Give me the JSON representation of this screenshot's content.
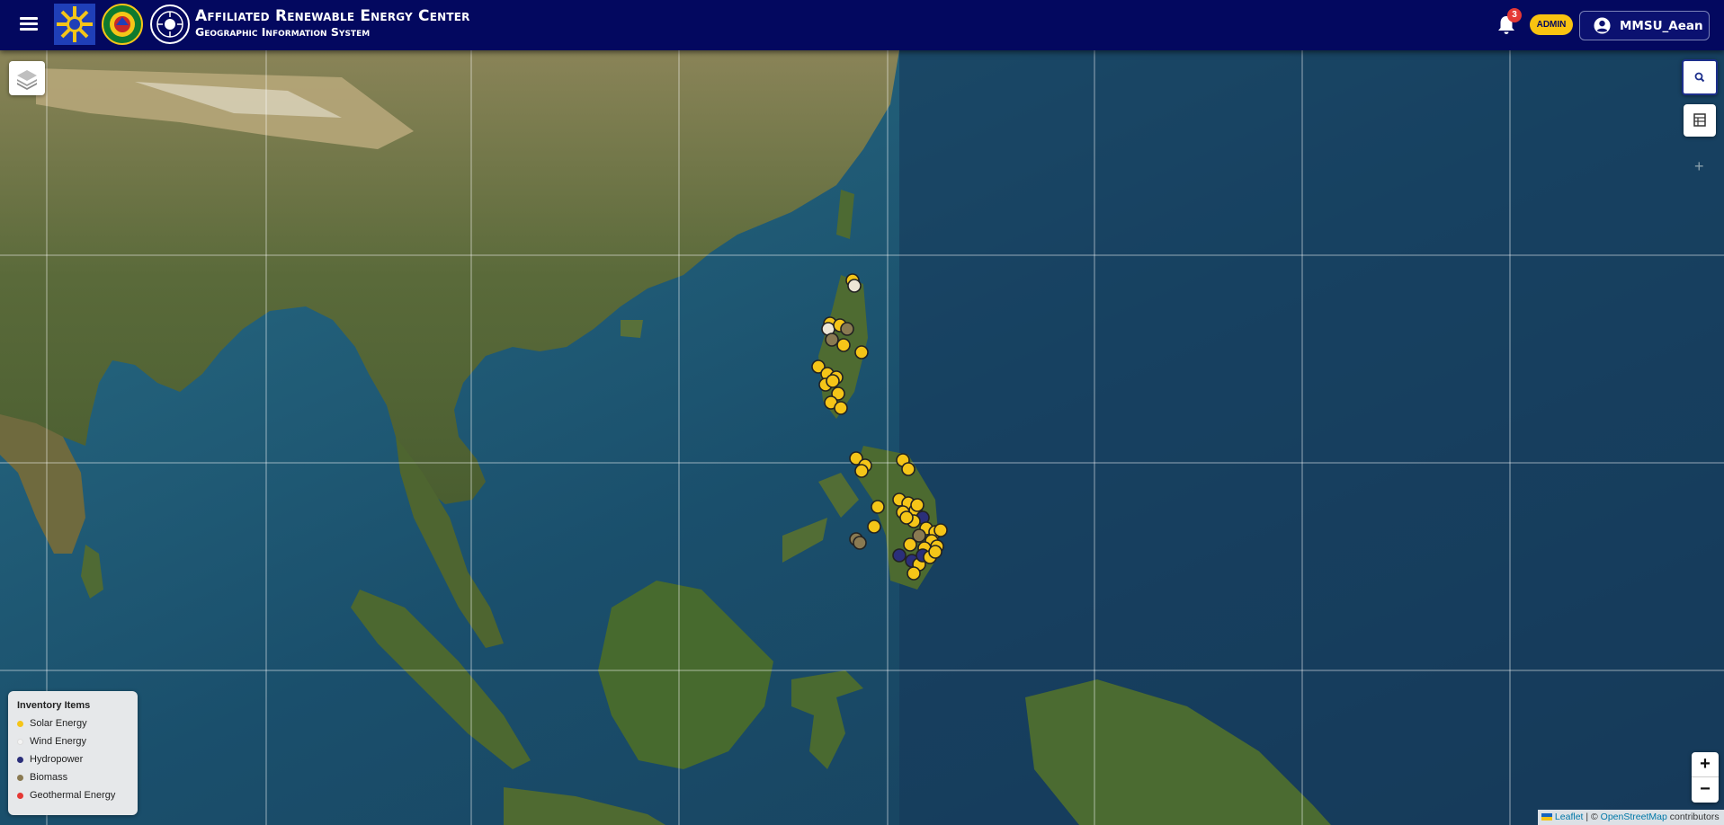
{
  "header": {
    "title": "Affiliated Renewable Energy Center",
    "subtitle": "Geographic Information System",
    "notification_count": "3",
    "role_badge": "ADMIN",
    "username": "MMSU_Aean"
  },
  "map": {
    "basemap": "satellite imagery",
    "legend": {
      "title": "Inventory Items",
      "items": [
        {
          "label": "Solar Energy",
          "color": "#f5c518"
        },
        {
          "label": "Wind Energy",
          "color": "#f4f4f4"
        },
        {
          "label": "Hydropower",
          "color": "#2b2f7a"
        },
        {
          "label": "Biomass",
          "color": "#8a7a52"
        },
        {
          "label": "Geothermal Energy",
          "color": "#e53935"
        }
      ]
    },
    "zoom_in": "+",
    "zoom_out": "−",
    "attribution": {
      "leaflet": "Leaflet",
      "separator": " | © ",
      "osm": "OpenStreetMap",
      "suffix": " contributors"
    }
  },
  "colors": {
    "header_bg": "#03085f",
    "accent": "#f9c310",
    "badge": "#e53935"
  },
  "icons": [
    "menu-icon",
    "layers-icon",
    "search-icon",
    "table-icon",
    "bell-icon",
    "user-icon"
  ]
}
